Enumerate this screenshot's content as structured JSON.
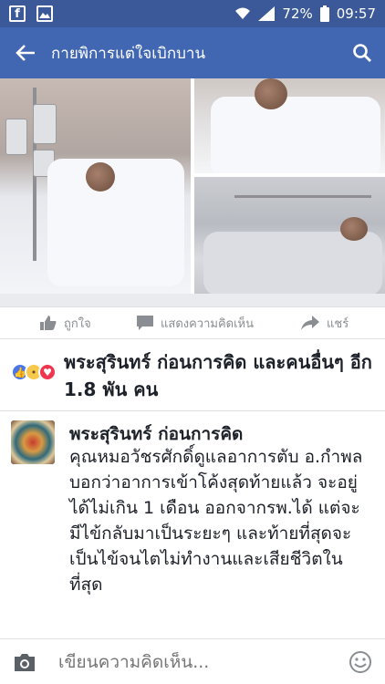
{
  "status_bar": {
    "battery": "72%",
    "time": "09:57",
    "icons": [
      "facebook-icon",
      "photo-icon",
      "wifi-icon",
      "signal-icon",
      "battery-icon"
    ]
  },
  "app_bar": {
    "title": "กายพิการแต่ใจเบิกบาน",
    "icons": [
      "back-arrow-icon",
      "search-icon"
    ]
  },
  "actions": {
    "like": "ถูกใจ",
    "comment": "แสดงความคิดเห็น",
    "share": "แชร์"
  },
  "reactions": {
    "text": "พระสุรินทร์ ก่อนการคิด และคนอื่นๆ อีก 1.8 พัน คน",
    "icons": [
      "like-reaction-icon",
      "sad-reaction-icon",
      "love-reaction-icon"
    ]
  },
  "comment": {
    "author": "พระสุรินทร์ ก่อนการคิด",
    "body": "คุณหมอวัชรศักดิ์ดูแลอาการตับ อ.กำพล บอกว่าอาการเข้าโค้งสุดท้ายแล้ว จะอยู่ได้ไม่เกิน 1 เดือน ออกจากรพ.ได้ แต่จะมีไข้กลับมาเป็นระยะๆ และท้ายที่สุดจะเป็นไข้จนไตไม่ทำงานและเสียชีวิตในที่สุด"
  },
  "composer": {
    "placeholder": "เขียนความคิดเห็น..."
  },
  "colors": {
    "header": "#4267b2",
    "status_bar": "#3b5998",
    "text": "#1d2129",
    "muted": "#8a8d91"
  }
}
